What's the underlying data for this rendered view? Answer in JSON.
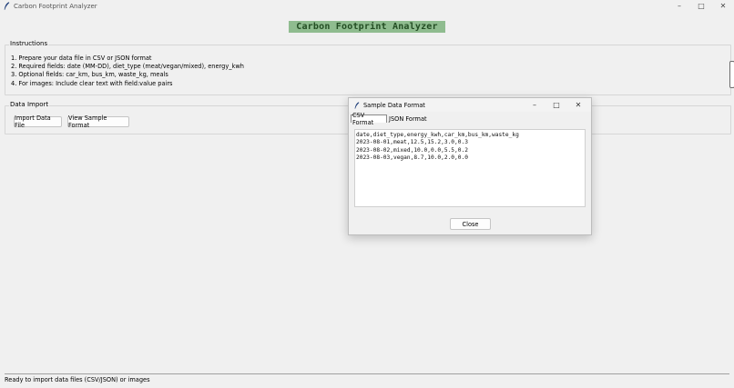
{
  "window": {
    "title": "Carbon Footprint Analyzer",
    "icon": "feather-icon",
    "controls": {
      "minimize": "–",
      "maximize": "□",
      "close": "✕"
    }
  },
  "heading": "Carbon Footprint Analyzer",
  "instructions": {
    "legend": "Instructions",
    "items": [
      "1. Prepare your data file in CSV or JSON format",
      "2. Required fields: date (MM-DD), diet_type (meat/vegan/mixed), energy_kwh",
      "3. Optional fields: car_km, bus_km, waste_kg, meals",
      "4. For images: Include clear text with field:value pairs"
    ]
  },
  "data_import": {
    "legend": "Data Import",
    "import_button": "Import Data File",
    "sample_button": "View Sample Format"
  },
  "status": "Ready to import data files (CSV/JSON) or images",
  "dialog": {
    "title": "Sample Data Format",
    "tabs": [
      "CSV Format",
      "JSON Format"
    ],
    "active_tab": "CSV Format",
    "content": "date,diet_type,energy_kwh,car_km,bus_km,waste_kg\n2023-08-01,meat,12.5,15.2,3.0,0.3\n2023-08-02,mixed,10.0,0.0,5.5,0.2\n2023-08-03,vegan,8.7,10.0,2.0,0.0",
    "close_button": "Close"
  },
  "colors": {
    "heading_bg": "#8fbc8f",
    "heading_text": "#234d23",
    "window_bg": "#f0f0f0"
  }
}
